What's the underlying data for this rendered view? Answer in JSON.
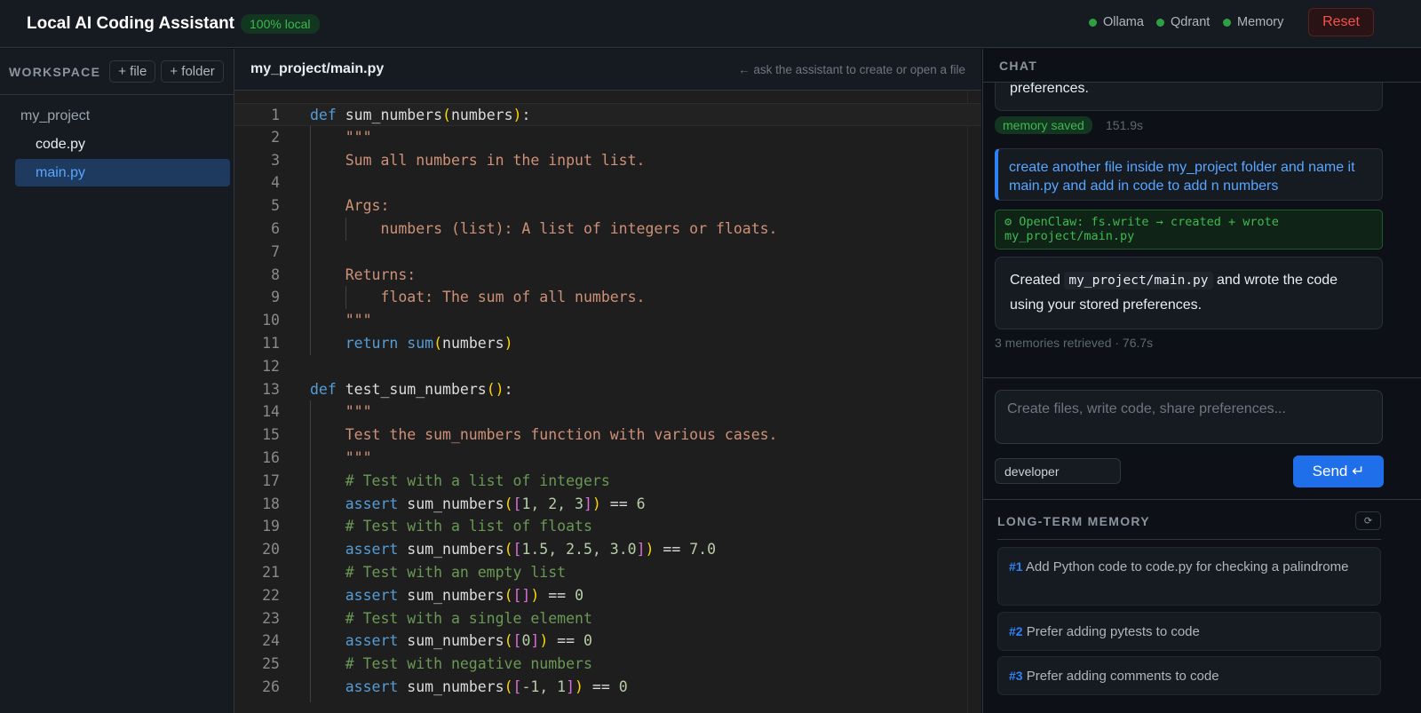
{
  "header": {
    "title": "Local AI Coding Assistant",
    "badge": "100% local",
    "status": [
      "Ollama",
      "Qdrant",
      "Memory"
    ],
    "reset_label": "Reset"
  },
  "sidebar": {
    "title": "WORKSPACE",
    "add_file": "+ file",
    "add_folder": "+ folder",
    "folder": "my_project",
    "files": [
      "code.py",
      "main.py"
    ]
  },
  "editor": {
    "path": "my_project/main.py",
    "hint": "← ask the assistant to create or open a file",
    "lines": [
      [
        [
          "kw",
          "def"
        ],
        [
          "fn",
          " sum_numbers"
        ],
        [
          "p1",
          "("
        ],
        [
          "fn",
          "numbers"
        ],
        [
          "p1",
          ")"
        ],
        [
          "fn",
          ":"
        ]
      ],
      [
        [
          "st",
          "    \"\"\""
        ]
      ],
      [
        [
          "st",
          "    Sum all numbers in the input list."
        ]
      ],
      [],
      [
        [
          "st",
          "    Args:"
        ]
      ],
      [
        [
          "st",
          "        numbers (list): A list of integers or floats."
        ]
      ],
      [],
      [
        [
          "st",
          "    Returns:"
        ]
      ],
      [
        [
          "st",
          "        float: The sum of all numbers."
        ]
      ],
      [
        [
          "st",
          "    \"\"\""
        ]
      ],
      [
        [
          "kw",
          "    return"
        ],
        [
          "fn",
          " "
        ],
        [
          "kw",
          "sum"
        ],
        [
          "p1",
          "("
        ],
        [
          "fn",
          "numbers"
        ],
        [
          "p1",
          ")"
        ]
      ],
      [],
      [
        [
          "kw",
          "def"
        ],
        [
          "fn",
          " test_sum_numbers"
        ],
        [
          "p1",
          "()"
        ],
        [
          "fn",
          ":"
        ]
      ],
      [
        [
          "st",
          "    \"\"\""
        ]
      ],
      [
        [
          "st",
          "    Test the sum_numbers function with various cases."
        ]
      ],
      [
        [
          "st",
          "    \"\"\""
        ]
      ],
      [
        [
          "cm",
          "    # Test with a list of integers"
        ]
      ],
      [
        [
          "kw",
          "    assert"
        ],
        [
          "fn",
          " sum_numbers"
        ],
        [
          "p1",
          "("
        ],
        [
          "p2",
          "["
        ],
        [
          "nm",
          "1, 2, 3"
        ],
        [
          "p2",
          "]"
        ],
        [
          "p1",
          ")"
        ],
        [
          "fn",
          " == "
        ],
        [
          "nm",
          "6"
        ]
      ],
      [
        [
          "cm",
          "    # Test with a list of floats"
        ]
      ],
      [
        [
          "kw",
          "    assert"
        ],
        [
          "fn",
          " sum_numbers"
        ],
        [
          "p1",
          "("
        ],
        [
          "p2",
          "["
        ],
        [
          "nm",
          "1.5, 2.5, 3.0"
        ],
        [
          "p2",
          "]"
        ],
        [
          "p1",
          ")"
        ],
        [
          "fn",
          " == "
        ],
        [
          "nm",
          "7.0"
        ]
      ],
      [
        [
          "cm",
          "    # Test with an empty list"
        ]
      ],
      [
        [
          "kw",
          "    assert"
        ],
        [
          "fn",
          " sum_numbers"
        ],
        [
          "p1",
          "("
        ],
        [
          "p2",
          "[]"
        ],
        [
          "p1",
          ")"
        ],
        [
          "fn",
          " == "
        ],
        [
          "nm",
          "0"
        ]
      ],
      [
        [
          "cm",
          "    # Test with a single element"
        ]
      ],
      [
        [
          "kw",
          "    assert"
        ],
        [
          "fn",
          " sum_numbers"
        ],
        [
          "p1",
          "("
        ],
        [
          "p2",
          "["
        ],
        [
          "nm",
          "0"
        ],
        [
          "p2",
          "]"
        ],
        [
          "p1",
          ")"
        ],
        [
          "fn",
          " == "
        ],
        [
          "nm",
          "0"
        ]
      ],
      [
        [
          "cm",
          "    # Test with negative numbers"
        ]
      ],
      [
        [
          "kw",
          "    assert"
        ],
        [
          "fn",
          " sum_numbers"
        ],
        [
          "p1",
          "("
        ],
        [
          "p2",
          "["
        ],
        [
          "nm",
          "-1, 1"
        ],
        [
          "p2",
          "]"
        ],
        [
          "p1",
          ")"
        ],
        [
          "fn",
          " == "
        ],
        [
          "nm",
          "0"
        ]
      ]
    ]
  },
  "chat": {
    "title": "CHAT",
    "prev_tail": "preferences.",
    "memory_saved": "memory saved",
    "prev_time": "151.9s",
    "user_msg": "create another file inside my_project folder and name it main.py and add in code to add n numbers",
    "tool_msg": "⚙ OpenClaw: fs.write → created + wrote my_project/main.py",
    "ai_pre": "Created",
    "ai_code": "my_project/main.py",
    "ai_post": "and wrote the code using your stored preferences.",
    "ai_meta": "3 memories retrieved · 76.7s",
    "input_placeholder": "Create files, write code, share preferences...",
    "user_value": "developer",
    "send_label": "Send ↵"
  },
  "memory": {
    "title": "LONG-TERM MEMORY",
    "refresh_icon": "⟳",
    "items": [
      {
        "num": "#1",
        "text": "Add Python code to code.py for checking a palindrome"
      },
      {
        "num": "#2",
        "text": "Prefer adding pytests to code"
      },
      {
        "num": "#3",
        "text": "Prefer adding comments to code"
      }
    ]
  }
}
